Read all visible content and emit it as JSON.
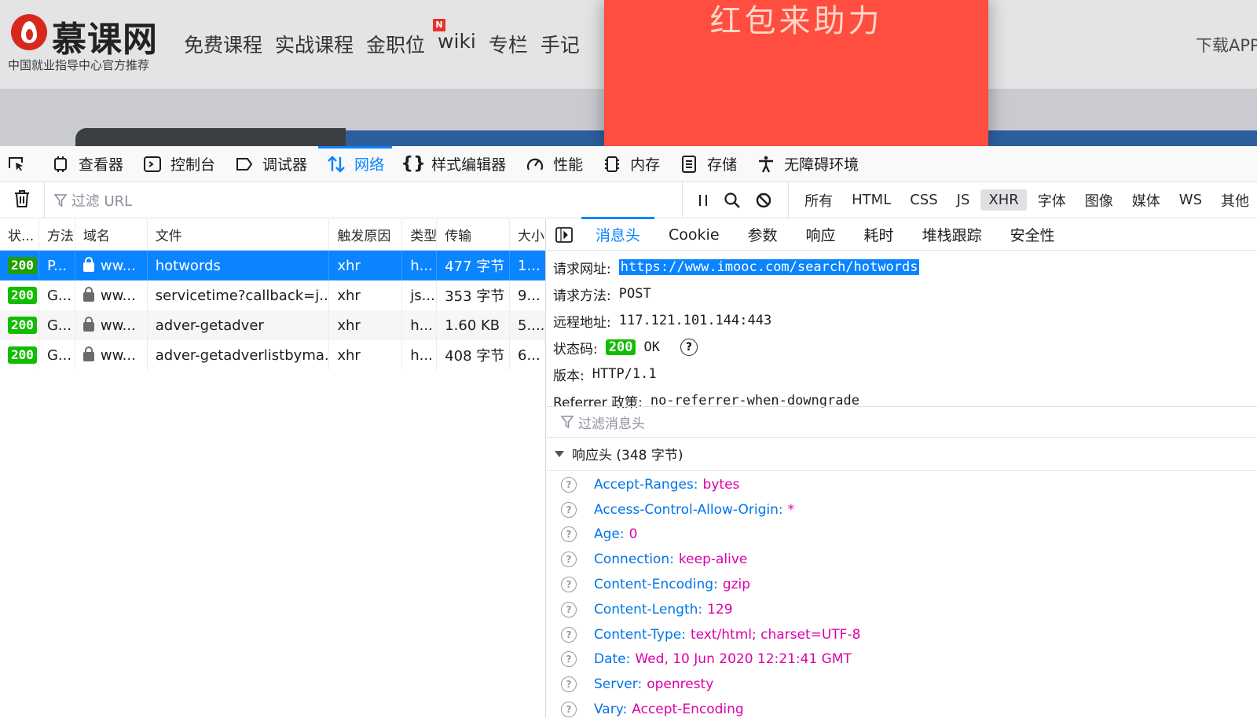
{
  "site": {
    "logo_text": "慕课网",
    "logo_subtitle": "中国就业指导中心官方推荐",
    "nav": [
      "免费课程",
      "实战课程",
      "金职位",
      "wiki",
      "专栏",
      "手记"
    ],
    "new_badge": "N",
    "download_app": "下载APP",
    "popup_title": "红包来助力"
  },
  "devtools": {
    "tools": [
      {
        "label": "查看器",
        "icon": "inspector-icon"
      },
      {
        "label": "控制台",
        "icon": "console-icon"
      },
      {
        "label": "调试器",
        "icon": "debugger-icon"
      },
      {
        "label": "网络",
        "icon": "network-icon",
        "active": true
      },
      {
        "label": "样式编辑器",
        "icon": "style-editor-icon"
      },
      {
        "label": "性能",
        "icon": "performance-icon"
      },
      {
        "label": "内存",
        "icon": "memory-icon"
      },
      {
        "label": "存储",
        "icon": "storage-icon"
      },
      {
        "label": "无障碍环境",
        "icon": "accessibility-icon"
      }
    ],
    "filter_placeholder": "过滤 URL",
    "type_filters": [
      "所有",
      "HTML",
      "CSS",
      "JS",
      "XHR",
      "字体",
      "图像",
      "媒体",
      "WS",
      "其他"
    ],
    "type_filter_active": "XHR",
    "accent": "#0a84ff"
  },
  "requests": {
    "columns": [
      "状...",
      "方法",
      "域名",
      "文件",
      "触发原因",
      "类型",
      "传输",
      "大小"
    ],
    "rows": [
      {
        "status": "200",
        "method": "P...",
        "domain": "ww...",
        "file": "hotwords",
        "cause": "xhr",
        "type": "h...",
        "transfer": "477 字节",
        "size": "1...",
        "selected": true
      },
      {
        "status": "200",
        "method": "G...",
        "domain": "ww...",
        "file": "servicetime?callback=j...",
        "cause": "xhr",
        "type": "js...",
        "transfer": "353 字节",
        "size": "9..."
      },
      {
        "status": "200",
        "method": "G...",
        "domain": "ww...",
        "file": "adver-getadver",
        "cause": "xhr",
        "type": "h...",
        "transfer": "1.60 KB",
        "size": "5...."
      },
      {
        "status": "200",
        "method": "G...",
        "domain": "ww...",
        "file": "adver-getadverlistbyma...",
        "cause": "xhr",
        "type": "h...",
        "transfer": "408 字节",
        "size": "6..."
      }
    ]
  },
  "detail": {
    "tabs": [
      "消息头",
      "Cookie",
      "参数",
      "响应",
      "耗时",
      "堆栈跟踪",
      "安全性"
    ],
    "active_tab": "消息头",
    "summary": {
      "url_label": "请求网址:",
      "url": "https://www.imooc.com/search/hotwords",
      "method_label": "请求方法:",
      "method": "POST",
      "remote_label": "远程地址:",
      "remote": "117.121.101.144:443",
      "status_label": "状态码:",
      "status_code": "200",
      "status_text": "OK",
      "version_label": "版本:",
      "version": "HTTP/1.1",
      "referrer_label": "Referrer 政策:",
      "referrer": "no-referrer-when-downgrade"
    },
    "header_filter_placeholder": "过滤消息头",
    "response_headers_title": "响应头 (348 字节)",
    "response_headers": [
      {
        "name": "Accept-Ranges:",
        "value": "bytes"
      },
      {
        "name": "Access-Control-Allow-Origin:",
        "value": "*"
      },
      {
        "name": "Age:",
        "value": "0"
      },
      {
        "name": "Connection:",
        "value": "keep-alive"
      },
      {
        "name": "Content-Encoding:",
        "value": "gzip"
      },
      {
        "name": "Content-Length:",
        "value": "129"
      },
      {
        "name": "Content-Type:",
        "value": "text/html; charset=UTF-8"
      },
      {
        "name": "Date:",
        "value": "Wed, 10 Jun 2020 12:21:41 GMT"
      },
      {
        "name": "Server:",
        "value": "openresty"
      },
      {
        "name": "Vary:",
        "value": "Accept-Encoding"
      }
    ]
  }
}
